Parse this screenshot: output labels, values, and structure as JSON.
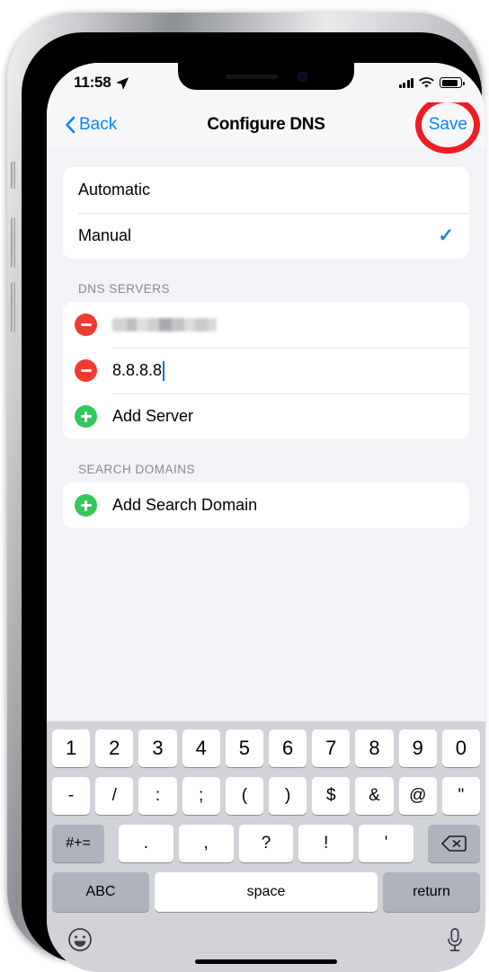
{
  "status_bar": {
    "time": "11:58",
    "location_icon": "location-arrow-icon",
    "cellular_icon": "cellular-signal-icon",
    "wifi_icon": "wifi-icon",
    "battery_icon": "battery-icon"
  },
  "nav_bar": {
    "back_label": "Back",
    "title": "Configure DNS",
    "save_label": "Save",
    "highlight_color": "#ee1d24",
    "tint_color": "#0a84ff"
  },
  "mode_group": {
    "options": [
      {
        "label": "Automatic",
        "selected": false
      },
      {
        "label": "Manual",
        "selected": true
      }
    ],
    "check_glyph": "✓",
    "check_color": "#2f7ed8"
  },
  "dns_servers": {
    "header": "DNS SERVERS",
    "entries": [
      {
        "value": "",
        "redacted": true,
        "action_icon": "minus-circle-icon"
      },
      {
        "value": "8.8.8.8",
        "redacted": false,
        "action_icon": "minus-circle-icon",
        "editing": true
      }
    ],
    "add_label": "Add Server",
    "add_icon": "plus-circle-icon"
  },
  "search_domains": {
    "header": "SEARCH DOMAINS",
    "add_label": "Add Search Domain",
    "add_icon": "plus-circle-icon"
  },
  "keyboard": {
    "row1": [
      "1",
      "2",
      "3",
      "4",
      "5",
      "6",
      "7",
      "8",
      "9",
      "0"
    ],
    "row2": [
      "-",
      "/",
      ":",
      ";",
      "(",
      ")",
      "$",
      "&",
      "@",
      "\""
    ],
    "row3_toggle": "#+=",
    "row3": [
      ".",
      ",",
      "?",
      "!",
      "'"
    ],
    "row3_backspace_icon": "backspace-icon",
    "row4": {
      "abc": "ABC",
      "space": "space",
      "return": "return"
    },
    "bottom": {
      "emoji_icon": "emoji-smiley-icon",
      "dictation_icon": "microphone-icon"
    }
  }
}
